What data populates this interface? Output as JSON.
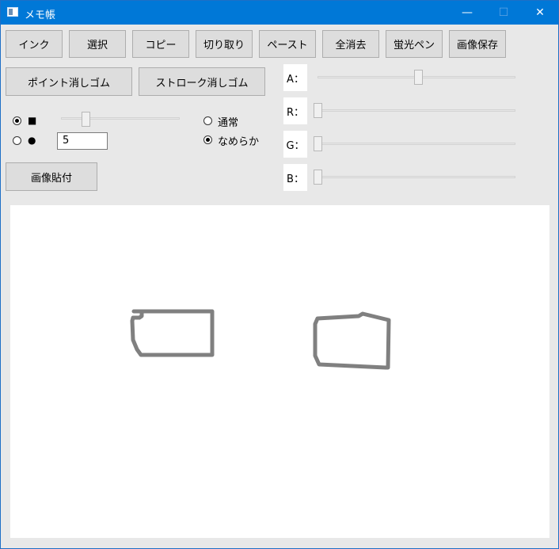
{
  "window": {
    "title": "メモ帳",
    "min_glyph": "—",
    "max_glyph": "☐",
    "close_glyph": "✕"
  },
  "toolbar": [
    "インク",
    "選択",
    "コピー",
    "切り取り",
    "ペースト",
    "全消去",
    "蛍光ペン",
    "画像保存"
  ],
  "eraser": {
    "point_label": "ポイント消しゴム",
    "stroke_label": "ストローク消しゴム"
  },
  "pen_shape": {
    "square_glyph": "■",
    "circle_glyph": "●",
    "selected": "square"
  },
  "pen_size": {
    "value": "5",
    "slider_fraction": 0.2
  },
  "mode": {
    "normal_label": "通常",
    "smooth_label": "なめらか",
    "selected": "smooth"
  },
  "paste_image_label": "画像貼付",
  "argb": [
    {
      "label": "A：",
      "fraction": 0.5
    },
    {
      "label": "R：",
      "fraction": 0.0
    },
    {
      "label": "G：",
      "fraction": 0.0
    },
    {
      "label": "B：",
      "fraction": 0.0
    }
  ],
  "stroke_color": "#808080"
}
